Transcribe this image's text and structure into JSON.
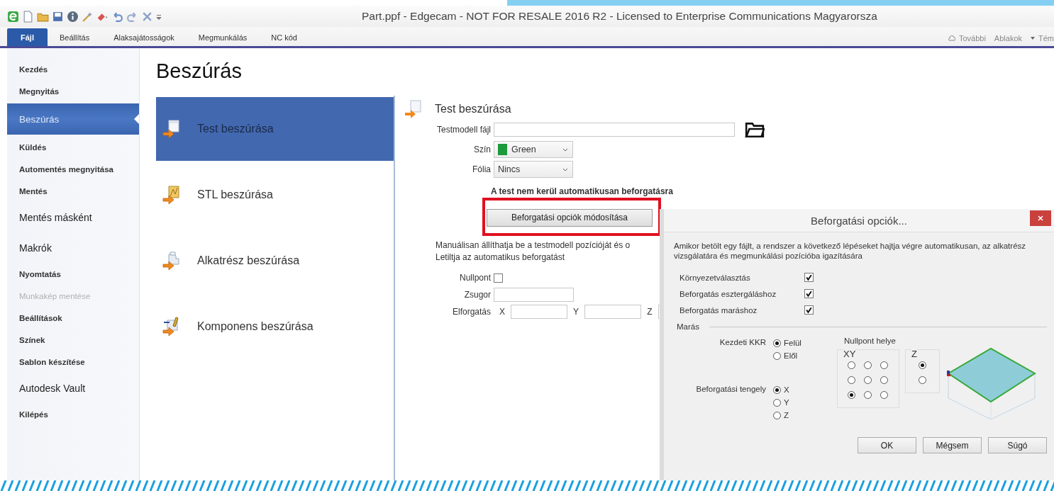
{
  "window": {
    "title": "Part.ppf - Edgecam - NOT FOR RESALE 2016 R2  - Licensed to Enterprise Communications Magyarorsza"
  },
  "ribbon": {
    "tabs": [
      {
        "label": "Fájl",
        "selected": true
      },
      {
        "label": "Beállítás",
        "selected": false
      },
      {
        "label": "Alaksajátosságok",
        "selected": false
      },
      {
        "label": "Megmunkálás",
        "selected": false
      },
      {
        "label": "NC kód",
        "selected": false
      }
    ],
    "right_items": [
      {
        "label": "További"
      },
      {
        "label": "Ablakok"
      },
      {
        "label": "Tém"
      }
    ]
  },
  "sidebar": {
    "items": [
      {
        "label": "Kezdés",
        "kind": "small",
        "selected": false,
        "disabled": false
      },
      {
        "label": "Megnyitás",
        "kind": "small",
        "selected": false,
        "disabled": false
      },
      {
        "label": "Beszúrás",
        "kind": "small",
        "selected": true,
        "disabled": false
      },
      {
        "label": "Küldés",
        "kind": "small",
        "selected": false,
        "disabled": false
      },
      {
        "label": "Automentés megnyitása",
        "kind": "small",
        "selected": false,
        "disabled": false
      },
      {
        "label": "Mentés",
        "kind": "small",
        "selected": false,
        "disabled": false
      },
      {
        "label": "Mentés másként",
        "kind": "large",
        "selected": false,
        "disabled": false
      },
      {
        "label": "Makrók",
        "kind": "large",
        "selected": false,
        "disabled": false
      },
      {
        "label": "Nyomtatás",
        "kind": "small",
        "selected": false,
        "disabled": false
      },
      {
        "label": "Munkakép mentése",
        "kind": "small",
        "selected": false,
        "disabled": true
      },
      {
        "label": "Beállítások",
        "kind": "small",
        "selected": false,
        "disabled": false
      },
      {
        "label": "Színek",
        "kind": "small",
        "selected": false,
        "disabled": false
      },
      {
        "label": "Sablon készítése",
        "kind": "small",
        "selected": false,
        "disabled": false
      },
      {
        "label": "Autodesk Vault",
        "kind": "large",
        "selected": false,
        "disabled": false
      },
      {
        "label": "Kilépés",
        "kind": "small",
        "selected": false,
        "disabled": false
      }
    ]
  },
  "page": {
    "heading": "Beszúrás",
    "commands": [
      {
        "label": "Test beszúrása",
        "selected": true
      },
      {
        "label": "STL beszúrása",
        "selected": false
      },
      {
        "label": "Alkatrész beszúrása",
        "selected": false
      },
      {
        "label": "Komponens beszúrása",
        "selected": false
      }
    ]
  },
  "form": {
    "title": "Test beszúrása",
    "model_file": {
      "label": "Testmodell fájl"
    },
    "color": {
      "label": "Szín",
      "value": "Green",
      "color": "#1c9a3c"
    },
    "foil": {
      "label": "Fólia",
      "value": "Nincs"
    },
    "note": "A test nem kerül automatikusan beforgatásra",
    "options_button": {
      "label": "Beforgatási opciók módosítása",
      "highlighted": true
    },
    "manual_text": [
      "Manuálisan állíthatja be a testmodell pozícióját és o",
      "Letiltja az automatikus beforgatást"
    ],
    "origin": {
      "label": "Nullpont",
      "checked": false
    },
    "shrink": {
      "label": "Zsugor"
    },
    "rotation": {
      "label": "Elforgatás",
      "axes": [
        "X",
        "Y",
        "Z"
      ]
    }
  },
  "dialog": {
    "title": "Beforgatási opciók...",
    "description": "Amikor betölt egy fájlt, a rendszer a következő lépéseket hajtja végre automatikusan, az alkatrész vizsgálatára és megmunkálási pozícióba igazítására",
    "checks": [
      {
        "label": "Környezetválasztás",
        "checked": true
      },
      {
        "label": "Beforgatás esztergáláshoz",
        "checked": true
      },
      {
        "label": "Beforgatás maráshoz",
        "checked": true
      }
    ],
    "milling": {
      "title": "Marás",
      "start_wcs": {
        "label": "Kezdeti KKR",
        "options": [
          {
            "label": "Felül",
            "selected": true
          },
          {
            "label": "Elől",
            "selected": false
          }
        ]
      },
      "axis": {
        "label": "Beforgatási tengely",
        "options": [
          {
            "label": "X",
            "selected": true
          },
          {
            "label": "Y",
            "selected": false
          },
          {
            "label": "Z",
            "selected": false
          }
        ]
      },
      "origin": {
        "label": "Nullpont helye",
        "xy_label": "XY",
        "xy": [
          [
            {
              "selected": false
            },
            {
              "selected": false
            },
            {
              "selected": false
            }
          ],
          [
            {
              "selected": false
            },
            {
              "selected": false
            },
            {
              "selected": false
            }
          ],
          [
            {
              "selected": true
            },
            {
              "selected": false
            },
            {
              "selected": false
            }
          ]
        ],
        "z_label": "Z",
        "z": [
          {
            "selected": true
          },
          {
            "selected": false
          }
        ]
      }
    },
    "buttons": [
      "OK",
      "Mégsem",
      "Súgó"
    ]
  }
}
